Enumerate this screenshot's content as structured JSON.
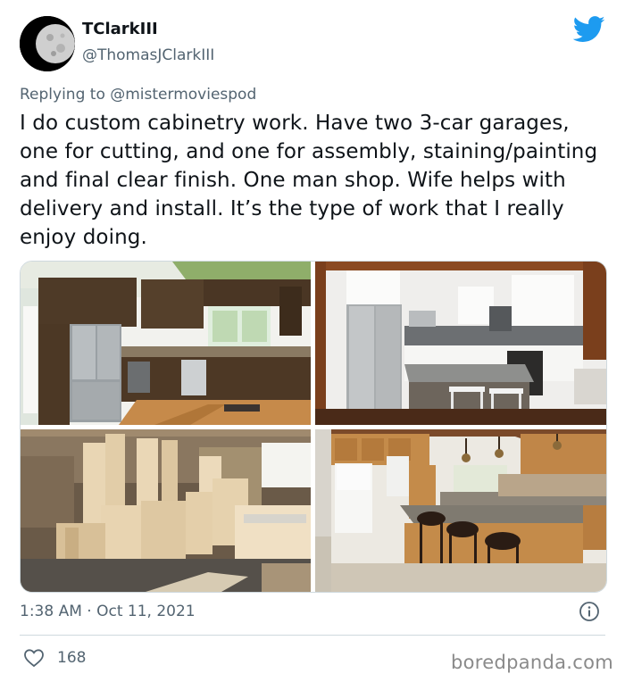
{
  "user": {
    "display_name": "TClarkIII",
    "handle": "@ThomasJClarkIII",
    "avatar_icon": "moon-avatar"
  },
  "platform_icon": "twitter-bird-icon",
  "reply": {
    "prefix": "Replying to",
    "handle": "@mistermoviespod"
  },
  "tweet": {
    "text": "I do custom cabinetry work. Have two 3-car garages, one for cutting, and one for assembly, staining/painting and final clear finish. One man shop. Wife helps with delivery and install. It’s the type of work that I really enjoy doing."
  },
  "photos": [
    {
      "subject": "dark-wood-kitchen-photo"
    },
    {
      "subject": "white-kitchen-island-photo"
    },
    {
      "subject": "garage-cabinet-assembly-photo"
    },
    {
      "subject": "oak-kitchen-barstools-photo"
    }
  ],
  "meta": {
    "timestamp": "1:38 AM · Oct 11, 2021"
  },
  "engagement": {
    "likes": "168"
  },
  "watermark": "boredpanda.com",
  "colors": {
    "twitter_blue": "#1d9bf0",
    "secondary_text": "#536471",
    "divider": "#cfd9de"
  }
}
